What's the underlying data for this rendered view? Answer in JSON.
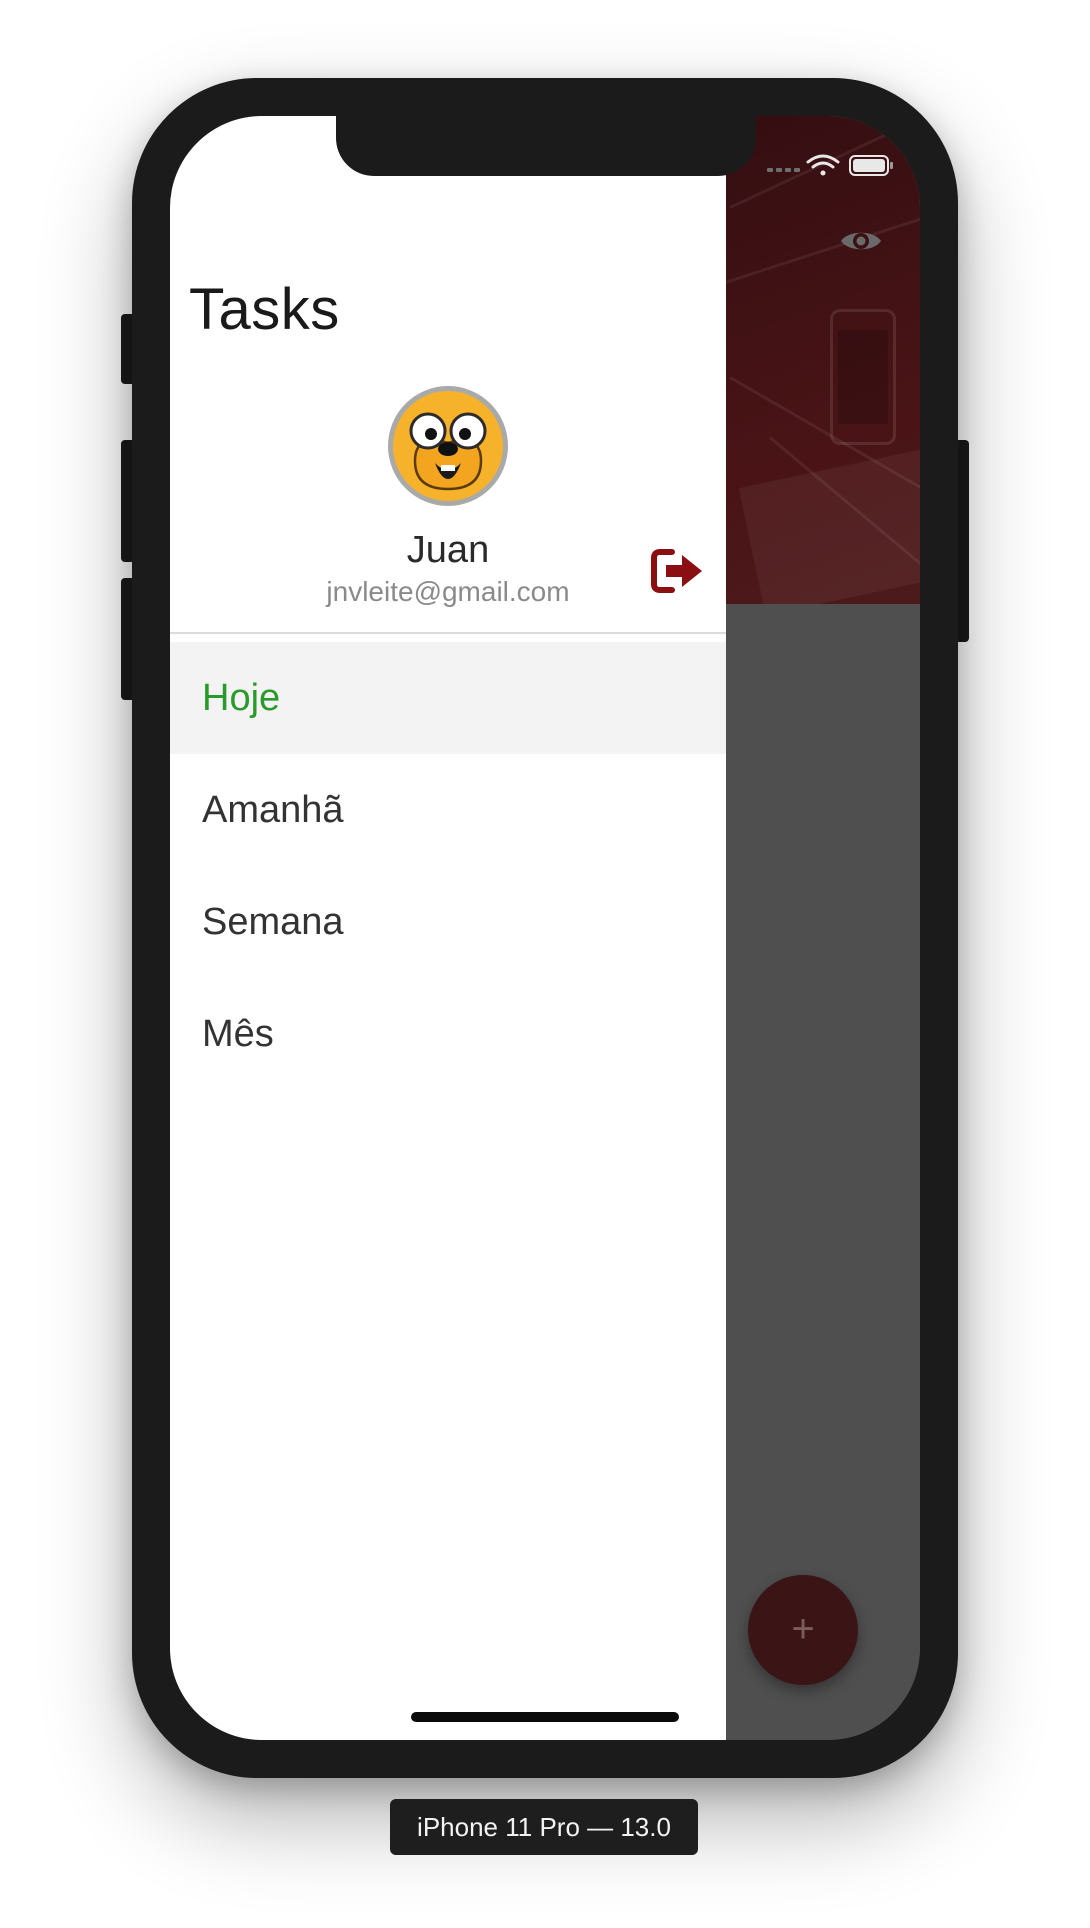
{
  "drawer": {
    "title": "Tasks",
    "user": {
      "name": "Juan",
      "email": "jnvleite@gmail.com"
    },
    "menu": [
      {
        "label": "Hoje",
        "active": true
      },
      {
        "label": "Amanhã",
        "active": false
      },
      {
        "label": "Semana",
        "active": false
      },
      {
        "label": "Mês",
        "active": false
      }
    ]
  },
  "background_app": {
    "fab_label": "+"
  },
  "simulator": {
    "device_label": "iPhone 11 Pro — 13.0"
  },
  "colors": {
    "active_item": "#2a9a2a",
    "logout_icon": "#8b0f12",
    "header_dark": "#3a1013",
    "avatar_yellow": "#f7b22b"
  },
  "icons": {
    "logout": "sign-out-icon",
    "visibility": "eye-icon",
    "wifi": "wifi-icon",
    "battery": "battery-icon",
    "signal": "signal-icon"
  }
}
